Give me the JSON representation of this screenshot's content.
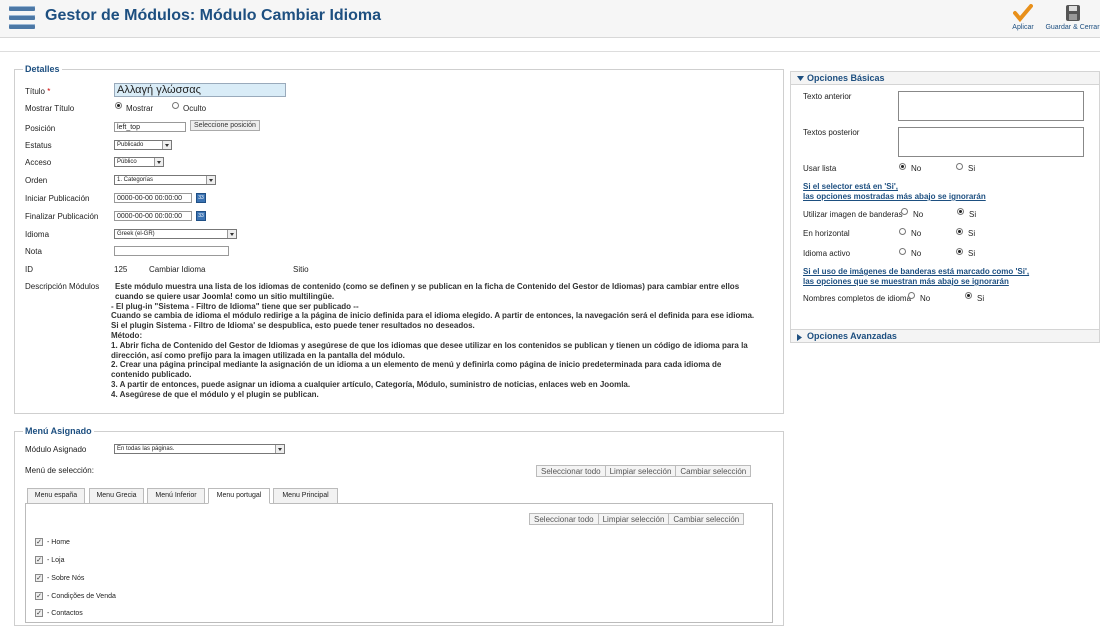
{
  "header": {
    "title": "Gestor de Módulos: Módulo Cambiar Idioma",
    "apply_label": "Aplicar",
    "save_close_label": "Guardar & Cerrar"
  },
  "details": {
    "legend": "Detalles",
    "title_label": "Título",
    "title_value": "Αλλαγή γλώσσας",
    "show_title_label": "Mostrar Título",
    "show_option": "Mostrar",
    "hide_option": "Oculto",
    "position_label": "Posición",
    "position_value": "left_top",
    "select_position_button": "Seleccione posición",
    "status_label": "Estatus",
    "status_value": "Publicado",
    "access_label": "Acceso",
    "access_value": "Público",
    "order_label": "Orden",
    "order_value": "1. Categorías",
    "start_pub_label": "Iniciar Publicación",
    "start_pub_value": "0000-00-00 00:00:00",
    "end_pub_label": "Finalizar Publicación",
    "end_pub_value": "0000-00-00 00:00:00",
    "language_label": "Idioma",
    "language_value": "Greek (el-GR)",
    "note_label": "Nota",
    "note_value": "",
    "id_label": "ID",
    "id_value": "125",
    "module_name": "Cambiar Idioma",
    "site_label": "Sitio",
    "description_label": "Descripción Módulos",
    "description_lines": [
      "Este módulo muestra una lista de los idiomas de contenido (como se definen y se publican en la ficha de Contenido del Gestor de Idiomas) para cambiar entre ellos",
      "cuando se quiere usar Joomla! como un sitio multilingüe.",
      "- El plug-in \"Sistema - Filtro de Idioma\" tiene que ser publicado --",
      "Cuando se cambia de idioma el módulo redirige a la página de inicio definida para el idioma elegido. A partir de entonces, la navegación será el definida para ese idioma.",
      "Si el plugin Sistema - Filtro de Idioma' se despublica, esto puede tener resultados no deseados.",
      "Método:",
      "1. Abrir ficha de Contenido del Gestor de Idiomas y asegúrese de que los idiomas que desee utilizar en los contenidos se publican y tienen un código de idioma para la",
      "dirección, así como prefijo para la imagen utilizada en la pantalla del módulo.",
      "2. Crear una página principal mediante la asignación de un idioma a un elemento de menú y definirla como página de inicio predeterminada para cada idioma de",
      "contenido publicado.",
      "3. A partir de entonces, puede asignar un idioma a cualquier artículo, Categoría, Módulo, suministro de noticias, enlaces web en Joomla.",
      "4. Asegúrese de que el módulo y el plugin se publican."
    ]
  },
  "menu": {
    "legend": "Menú Asignado",
    "assigned_label": "Módulo Asignado",
    "assigned_value": "En todas las páginas.",
    "selection_label": "Menú de selección:",
    "select_all": "Seleccionar todo",
    "clear_selection": "Limpiar selección",
    "toggle_selection": "Cambiar selección",
    "tabs": [
      "Menu españa",
      "Menu Grecia",
      "Menú Inferior",
      "Menu portugal",
      "Menu Principal"
    ],
    "items": [
      "- Home",
      "- Loja",
      "- Sobre Nós",
      "- Condições de Venda",
      "- Contactos"
    ]
  },
  "basic": {
    "header": "Opciones Básicas",
    "text_before_label": "Texto anterior",
    "text_after_label": "Textos posterior",
    "use_list_label": "Usar lista",
    "no": "No",
    "yes": "Si",
    "note1_line1": "Si el selector está en 'Si',",
    "note1_line2": "las opciones mostradas más abajo se ignorarán",
    "flags_label": "Utilizar imagen de banderas",
    "horizontal_label": "En horizontal",
    "active_lang_label": "Idioma activo",
    "note2_line1": "Si el uso de imágenes de banderas está marcado como 'Si',",
    "note2_line2": "las opciones que se muestran más abajo se ignorarán",
    "full_names_label": "Nombres completos de idioma"
  },
  "advanced": {
    "header": "Opciones Avanzadas"
  }
}
